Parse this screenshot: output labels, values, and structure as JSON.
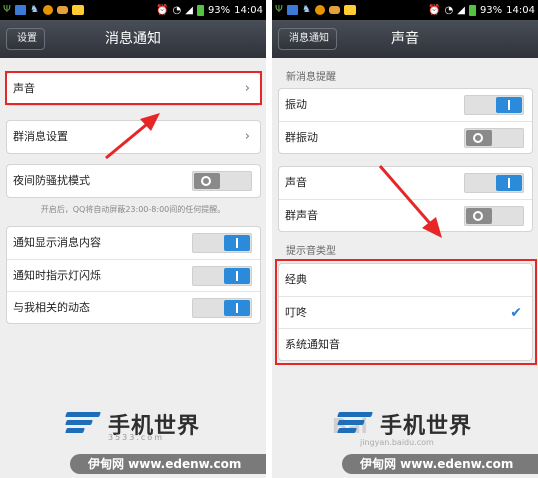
{
  "status_bar": {
    "left_icons": [
      "usb-icon",
      "image-icon",
      "bird-icon",
      "face-icon",
      "pill-icon",
      "box-icon"
    ],
    "right_icons": [
      "alarm-icon",
      "wifi-icon",
      "signal-icon",
      "battery-icon"
    ],
    "battery_percent": "93%",
    "time": "14:04"
  },
  "left_screen": {
    "back_label": "设置",
    "title": "消息通知",
    "rows": {
      "sound": "声音",
      "group_settings": "群消息设置",
      "night_mode": "夜间防骚扰模式",
      "show_content": "通知显示消息内容",
      "indicator_light": "通知时指示灯闪烁",
      "related_updates": "与我相关的动态"
    },
    "hint": "开启后，QQ将自动屏蔽23:00-8:00间的任何提醒。",
    "toggles": {
      "night_mode": false,
      "show_content": true,
      "indicator_light": true,
      "related_updates": true
    }
  },
  "right_screen": {
    "back_label": "消息通知",
    "title": "声音",
    "section_new_message": "新消息提醒",
    "rows": {
      "vibrate": "振动",
      "group_vibrate": "群振动",
      "sound": "声音",
      "group_sound": "群声音"
    },
    "toggles": {
      "vibrate": true,
      "group_vibrate": false,
      "sound": true,
      "group_sound": false
    },
    "section_tone_type": "提示音类型",
    "tones": [
      "经典",
      "叮咚",
      "系统通知音"
    ],
    "selected_tone": "叮咚"
  },
  "watermark": {
    "brand_cn": "手机世界",
    "brand_num": "3533.com",
    "site": "伊甸网  www.edenw.com",
    "baidu": "Bai",
    "baidu_url": "jingyan.baidu.com"
  },
  "colors": {
    "accent_blue": "#2b8ad9",
    "highlight_red": "#e52727",
    "title_bar": "#3a3d44"
  }
}
